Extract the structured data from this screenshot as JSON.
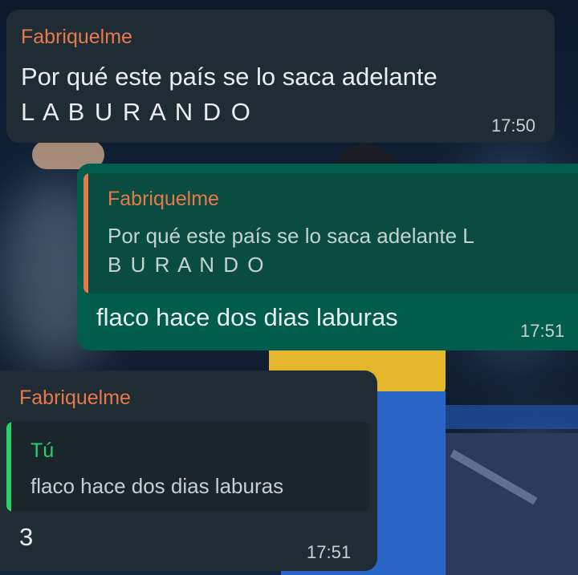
{
  "colors": {
    "incoming_bubble": "#1f2c34",
    "outgoing_bubble": "#005c4b",
    "sender_name": "#e7794a",
    "self_quote_name": "#25d366",
    "message_text": "#e9edef"
  },
  "messages": [
    {
      "direction": "incoming",
      "sender": "Fabriquelme",
      "text_line1": "Por qué este país se lo saca adelante",
      "text_line2": "L A B U R A N D O",
      "time": "17:50"
    },
    {
      "direction": "outgoing",
      "quote": {
        "sender": "Fabriquelme",
        "text_line1": "Por qué este país se lo saca adelante L",
        "text_line2": "B U R A N D O"
      },
      "text": "flaco hace dos dias laburas",
      "time": "17:51"
    },
    {
      "direction": "incoming",
      "sender": "Fabriquelme",
      "quote": {
        "sender": "Tú",
        "text": "flaco hace dos dias laburas"
      },
      "text": "3",
      "time": "17:51"
    }
  ]
}
